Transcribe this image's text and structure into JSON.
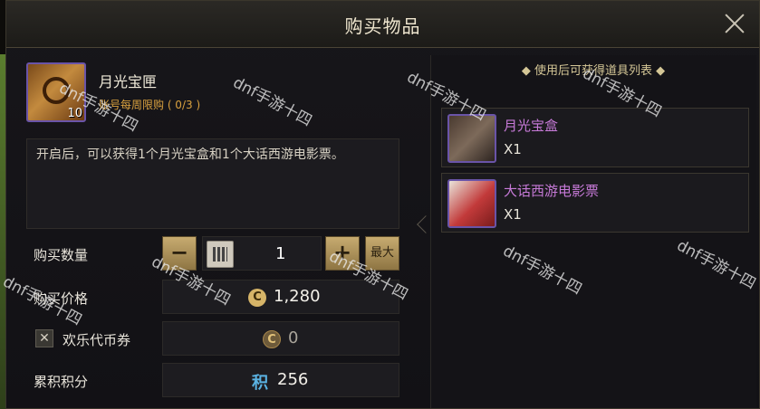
{
  "dialog": {
    "title": "购买物品",
    "close_icon": "close-icon"
  },
  "item": {
    "name": "月光宝匣",
    "count": "10",
    "limit": "账号每周限购 ( 0/3 )",
    "description": "开启后，可以获得1个月光宝盒和1个大话西游电影票。"
  },
  "purchase": {
    "quantity_label": "购买数量",
    "minus_label": "−",
    "plus_label": "+",
    "quantity": "1",
    "max_label": "最大",
    "price_label": "购买价格",
    "price": "1,280",
    "voucher_label": "欢乐代币券",
    "voucher_checked": true,
    "voucher_value": "0",
    "points_label": "累积积分",
    "points_icon_text": "积",
    "points": "256"
  },
  "rewards": {
    "title": "◆ 使用后可获得道具列表 ◆",
    "items": [
      {
        "name": "月光宝盒",
        "qty": "X1"
      },
      {
        "name": "大话西游电影票",
        "qty": "X1"
      }
    ]
  },
  "watermark": "dnf手游十四",
  "colors": {
    "gold": "#c7ab70",
    "limit_orange": "#d9a13f",
    "reward_purple": "#c77ad8",
    "frame_purple": "#6a54a8",
    "points_blue": "#5ab2e2"
  }
}
